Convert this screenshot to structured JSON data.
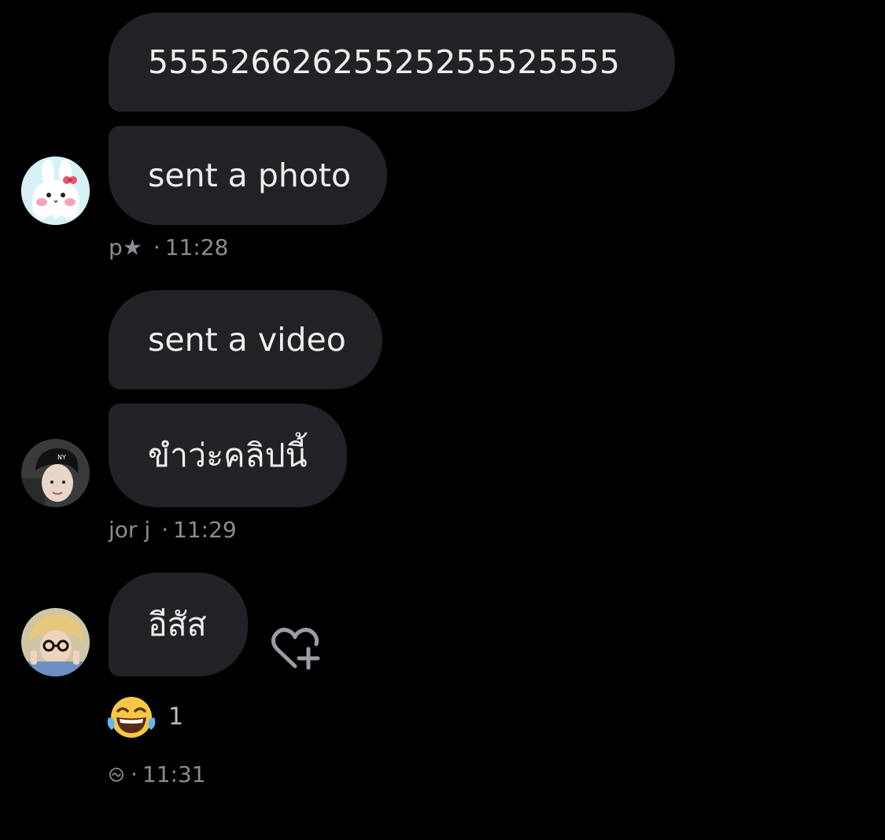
{
  "messages": [
    {
      "text": "5555266262552525555 25555",
      "text_clean": "55552662625525255525555"
    },
    {
      "text": "sent a photo"
    },
    {
      "text": "sent a video"
    },
    {
      "text": "ขำว่ะคลิปนี้"
    },
    {
      "text": "อีสัส"
    }
  ],
  "meta": [
    {
      "sender": "p★",
      "time": "11:28"
    },
    {
      "sender": "jor j",
      "time": "11:29"
    },
    {
      "sender": "",
      "time": "11:31"
    }
  ],
  "reaction": {
    "emoji": "😂",
    "count": "1"
  },
  "colors": {
    "background": "#000000",
    "bubble": "#202226",
    "text": "#eceef0",
    "meta": "#8a8d93"
  }
}
